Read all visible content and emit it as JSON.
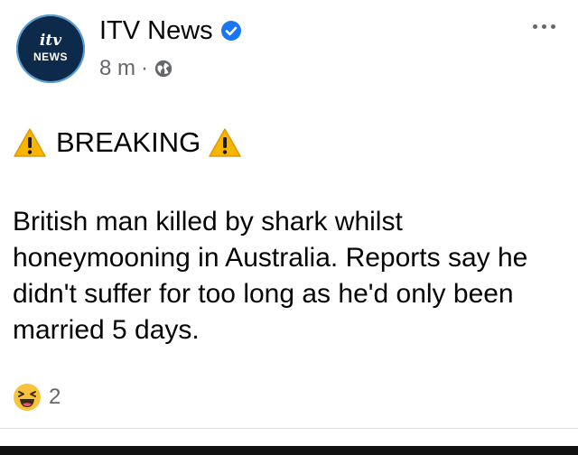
{
  "header": {
    "avatar": {
      "logo_top": "itv",
      "logo_bottom": "NEWS",
      "bg_color": "#0d2a4a"
    },
    "page_name": "ITV News",
    "verified_icon": "verified-badge-icon",
    "verified_color": "#1877f2",
    "timestamp": "8 m",
    "separator": "·",
    "audience_icon": "globe-icon"
  },
  "post": {
    "breaking_label": "BREAKING",
    "warning_icon": "warning-icon",
    "warning_color": "#f7b500",
    "body": "British man killed by shark whilst honeymooning in Australia. Reports say he didn't suffer for too long as he'd only been married 5 days."
  },
  "reactions": {
    "icon": "haha-reaction-icon",
    "count": "2"
  },
  "more_icon": "more-options-icon"
}
